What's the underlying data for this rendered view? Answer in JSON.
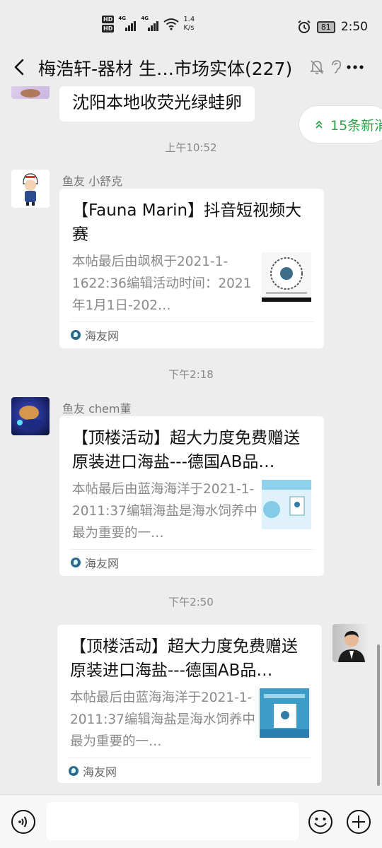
{
  "status_bar": {
    "hd1": "HD",
    "hd2": "HD",
    "net1": "4G",
    "net2": "4G",
    "speed_value": "1.4",
    "speed_unit": "K/s",
    "battery": "81",
    "time": "2:50"
  },
  "header": {
    "title": "梅浩轩-器材 生…市场实体(227)"
  },
  "new_messages_pill": {
    "label": "15条新消"
  },
  "messages": [
    {
      "type": "text",
      "text": "沈阳本地收荧光绿蛙卵"
    },
    {
      "type": "timestamp",
      "text": "上午10:52"
    },
    {
      "type": "card",
      "sender": "鱼友 小舒克",
      "title": "【Fauna Marin】抖音短视频大赛",
      "desc": "本帖最后由飒枫于2021-1-1622:36编辑活动时间：2021年1月1日-202…",
      "source": "海友网"
    },
    {
      "type": "timestamp",
      "text": "下午2:18"
    },
    {
      "type": "card",
      "sender": "鱼友 chem董",
      "title": "【顶楼活动】超大力度免费赠送原装进口海盐---德国AB品…",
      "desc": "本帖最后由蓝海海洋于2021-1-2011:37编辑海盐是海水饲养中最为重要的一…",
      "source": "海友网"
    },
    {
      "type": "timestamp",
      "text": "下午2:50"
    },
    {
      "type": "card",
      "sender": "",
      "title": "【顶楼活动】超大力度免费赠送原装进口海盐---德国AB品…",
      "desc": "本帖最后由蓝海海洋于2021-1-2011:37编辑海盐是海水饲养中最为重要的一…",
      "source": "海友网"
    }
  ],
  "input_bar": {
    "placeholder": ""
  },
  "colors": {
    "background": "#ededed",
    "accent_green": "#2ba245",
    "bubble": "#ffffff"
  }
}
